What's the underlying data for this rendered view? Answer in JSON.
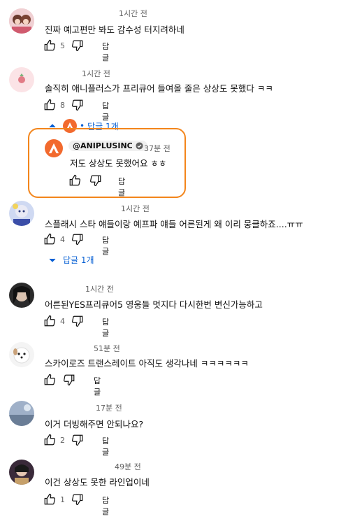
{
  "comments": [
    {
      "time": "1시간 전",
      "text": "진짜 예고편만 봐도 감수성 터지려하네",
      "likes": "5",
      "reply_label": "답글"
    },
    {
      "time": "1시간 전",
      "text": "솔직히 애니플러스가 프리큐어 들여올 줄은 상상도 못했다 ㅋㅋ",
      "likes": "8",
      "reply_label": "답글",
      "replies_toggle": "답글 1개",
      "reply": {
        "handle": "@ANIPLUSINC",
        "time": "37분 전",
        "text": "저도 상상도 못했어요 ㅎㅎ",
        "reply_label": "답글"
      }
    },
    {
      "time": "1시간 전",
      "text": "스플래시 스타 얘들이랑 예프파 얘들 어른된게 왜 이리 뭉클하죠....ㅠㅠ",
      "likes": "4",
      "reply_label": "답글",
      "replies_toggle": "답글 1개"
    },
    {
      "time": "1시간 전",
      "text": "어른된YES프리큐어5 영웅들 멋지다 다시한번 변신가능하고",
      "likes": "4",
      "reply_label": "답글"
    },
    {
      "time": "51분 전",
      "text": "스카이로즈 트랜스레이트 아직도 생각나네 ㅋㅋㅋㅋㅋㅋ",
      "likes": "",
      "reply_label": "답글"
    },
    {
      "time": "17분 전",
      "text": "이거 더빙해주면 안되나요?",
      "likes": "2",
      "reply_label": "답글"
    },
    {
      "time": "49분 전",
      "text": "이건 상상도 못한 라인업이네",
      "likes": "1",
      "reply_label": "답글"
    }
  ],
  "colors": {
    "link": "#065fd4",
    "highlight": "#f3851b",
    "aniplus": "#f26a2e"
  }
}
